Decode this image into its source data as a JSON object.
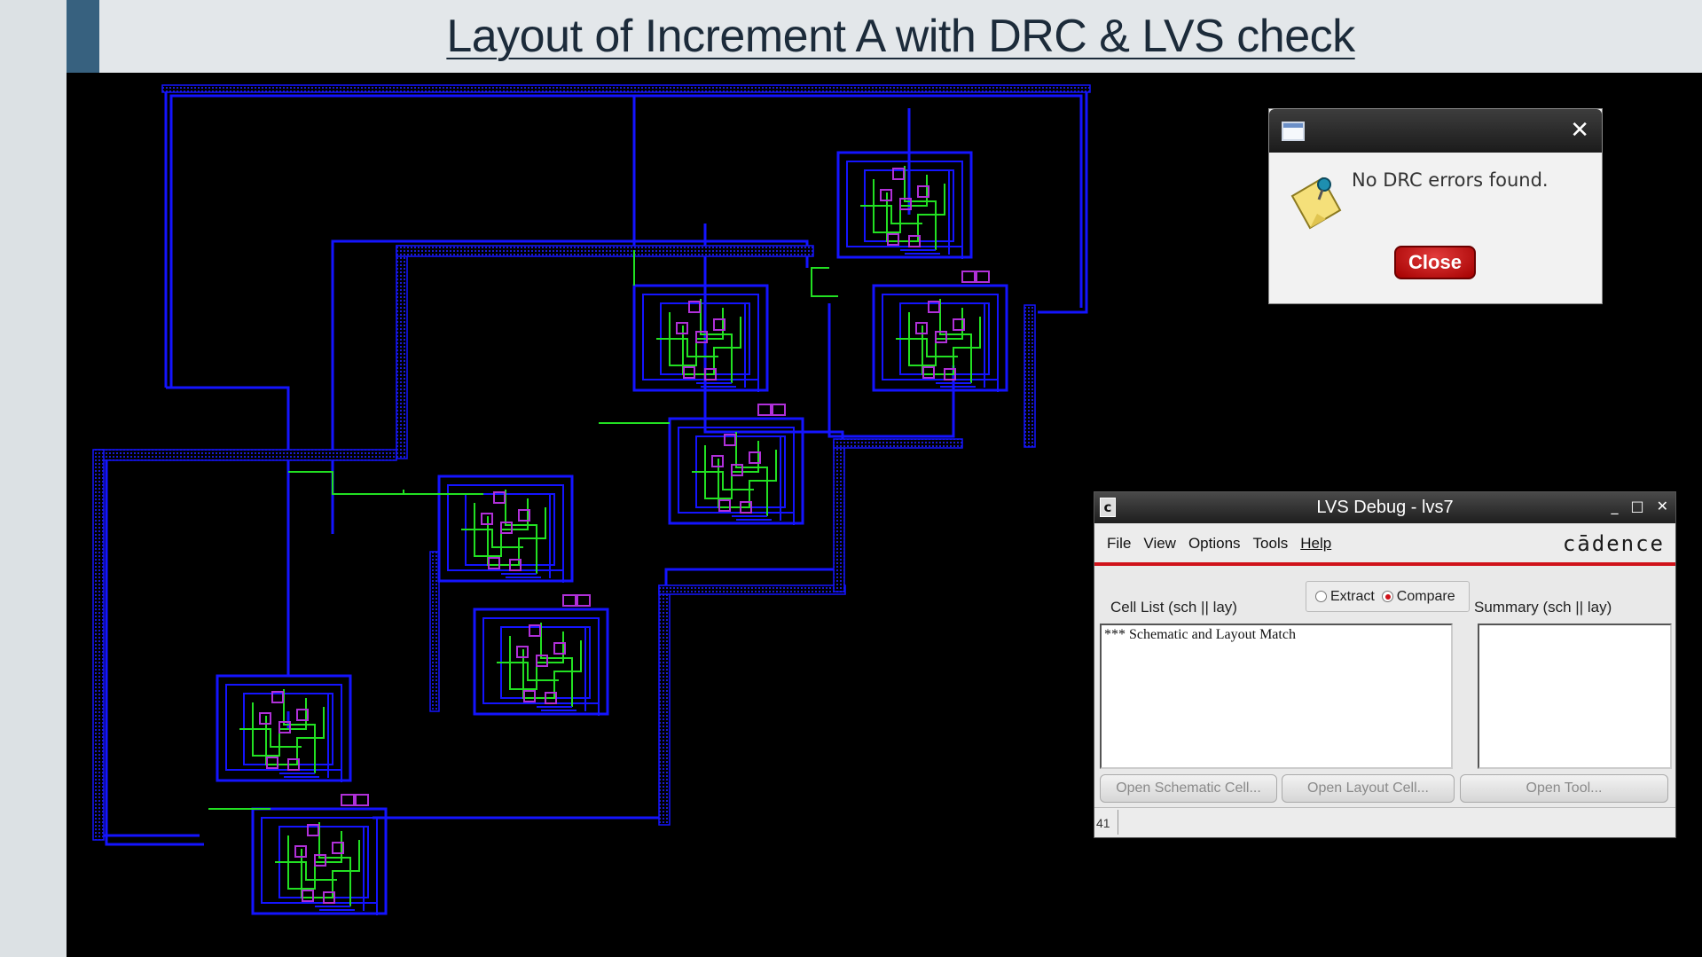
{
  "slide": {
    "title": "Layout of Increment A with DRC & LVS check"
  },
  "layout_canvas": {
    "colors": {
      "background": "#000000",
      "metal1": "#1414ff",
      "poly": "#22e022",
      "contact": "#b030d8",
      "dotted_track": "#1a1ad0"
    }
  },
  "drc_dialog": {
    "window_icon": "window-icon",
    "close_x": "✕",
    "note_icon": "pushpin-note-icon",
    "message": "No DRC errors found.",
    "close_button": "Close"
  },
  "lvs_window": {
    "app_icon": "c",
    "title": "LVS Debug - lvs7",
    "controls": {
      "minimize": "_",
      "maximize": "□",
      "close": "✕"
    },
    "menus": [
      "File",
      "View",
      "Options",
      "Tools",
      "Help"
    ],
    "brand": "cādence",
    "mode": {
      "extract_label": "Extract",
      "compare_label": "Compare",
      "selected": "Compare"
    },
    "cell_list_label": "Cell List (sch || lay)",
    "summary_label": "Summary (sch || lay)",
    "cell_list_text": "*** Schematic and Layout Match",
    "buttons": {
      "open_schematic": "Open Schematic Cell...",
      "open_layout": "Open Layout Cell...",
      "open_tool": "Open Tool..."
    },
    "status_number": "41"
  },
  "colors": {
    "accent": "#37617f",
    "cadence_red": "#d0121a",
    "close_button_red": "#c00000"
  }
}
